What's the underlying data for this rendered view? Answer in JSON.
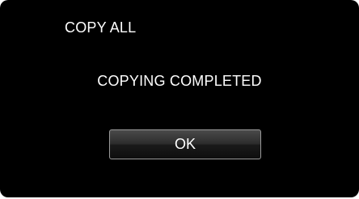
{
  "dialog": {
    "title": "COPY ALL",
    "message": "COPYING COMPLETED",
    "ok_label": "OK"
  },
  "colors": {
    "screen_background": "#000000",
    "text": "#ffffff",
    "button_border": "#9a9a9a"
  }
}
